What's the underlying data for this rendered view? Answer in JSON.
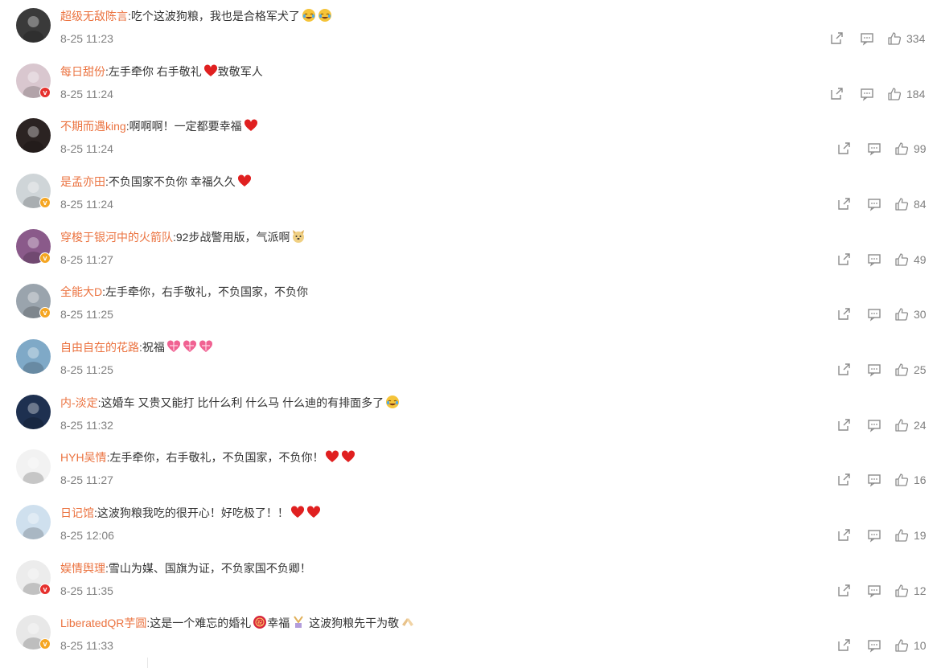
{
  "comments": [
    {
      "name": "超级无敌陈言",
      "text": ":吃个这波狗粮，我也是合格军犬了",
      "emojis": [
        "laugh-cry",
        "laugh-cry"
      ],
      "time": "8-25 11:23",
      "likes": "334",
      "badge": "",
      "avatar_color": "#3a3a3a"
    },
    {
      "name": "每日甜份",
      "text": ":左手牵你 右手敬礼",
      "text2": "致敬军人",
      "emojis": [
        "heart"
      ],
      "time": "8-25 11:24",
      "likes": "184",
      "badge": "red",
      "avatar_color": "#d9c7cf"
    },
    {
      "name": "不期而遇king",
      "text": ":啊啊啊！一定都要幸福",
      "emojis": [
        "heart"
      ],
      "time": "8-25 11:24",
      "likes": "99",
      "badge": "",
      "avatar_color": "#2b2322"
    },
    {
      "name": "是孟亦田",
      "text": ":不负国家不负你 幸福久久",
      "emojis": [
        "heart"
      ],
      "time": "8-25 11:24",
      "likes": "84",
      "badge": "orange",
      "avatar_color": "#cfd5d8"
    },
    {
      "name": "穿梭于银河中的火箭队",
      "text": ":92步战警用版，气派啊",
      "emojis": [
        "doge"
      ],
      "time": "8-25 11:27",
      "likes": "49",
      "badge": "orange",
      "avatar_color": "#8a5a8a"
    },
    {
      "name": "全能大D",
      "text": ":左手牵你，右手敬礼，不负国家，不负你",
      "emojis": [],
      "time": "8-25 11:25",
      "likes": "30",
      "badge": "orange",
      "avatar_color": "#9aa4ad"
    },
    {
      "name": "自由自在的花路",
      "text": ":祝福",
      "emojis": [
        "heart-gift",
        "heart-gift",
        "heart-gift"
      ],
      "time": "8-25 11:25",
      "likes": "25",
      "badge": "",
      "avatar_color": "#7fa9c7"
    },
    {
      "name": "内-淡定",
      "text": ":这婚车 又贵又能打 比什么利 什么马 什么迪的有排面多了",
      "emojis": [
        "laugh-cry"
      ],
      "time": "8-25 11:32",
      "likes": "24",
      "badge": "",
      "avatar_color": "#1e3050"
    },
    {
      "name": "HYH吴情",
      "text": ":左手牵你，右手敬礼，不负国家，不负你！",
      "emojis": [
        "heart",
        "heart"
      ],
      "time": "8-25 11:27",
      "likes": "16",
      "badge": "",
      "avatar_color": "#f2f2f2"
    },
    {
      "name": "日记馆",
      "text": ":这波狗粮我吃的很开心！好吃极了！！",
      "emojis": [
        "heart",
        "heart"
      ],
      "time": "8-25 12:06",
      "likes": "19",
      "badge": "",
      "avatar_color": "#cfe0ee"
    },
    {
      "name": "娱情舆理",
      "text": ":雪山为媒、国旗为证，不负家国不负卿！",
      "emojis": [],
      "time": "8-25 11:35",
      "likes": "12",
      "badge": "red",
      "avatar_color": "#ececec"
    },
    {
      "name": "LiberatedQR芋圆",
      "text": ":这是一个难忘的婚礼",
      "text2": "幸福",
      "text3": "这波狗粮先干为敬",
      "emojis": [
        "blessing"
      ],
      "emojis2": [
        "wedding"
      ],
      "emojis3": [
        "cheers"
      ],
      "time": "8-25 11:33",
      "likes": "10",
      "badge": "orange",
      "avatar_color": "#e8e8e8"
    }
  ],
  "colors": {
    "name": "#eb7340",
    "text": "#333333",
    "meta": "#808080",
    "icon": "#8c8c8c"
  }
}
